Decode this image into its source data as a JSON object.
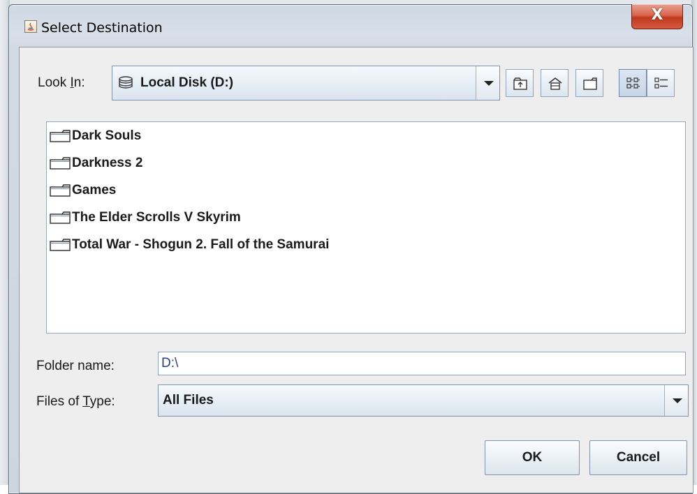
{
  "window": {
    "title": "Select Destination",
    "close_label": "X"
  },
  "look_in": {
    "label_pre": "Look ",
    "label_mnemonic": "I",
    "label_post": "n:",
    "value": "Local Disk (D:)",
    "icon": "drive-icon"
  },
  "toolbar": {
    "up_icon": "up-one-level-icon",
    "home_icon": "home-icon",
    "new_folder_icon": "new-folder-icon",
    "list_view_icon": "list-view-icon",
    "details_view_icon": "details-view-icon",
    "active_view": "list"
  },
  "files": [
    {
      "name": "Dark Souls",
      "icon": "folder-icon"
    },
    {
      "name": "Darkness 2",
      "icon": "folder-icon"
    },
    {
      "name": "Games",
      "icon": "folder-icon"
    },
    {
      "name": "The Elder Scrolls V Skyrim",
      "icon": "folder-icon"
    },
    {
      "name": "Total War - Shogun 2. Fall of the Samurai",
      "icon": "folder-icon"
    }
  ],
  "folder_name": {
    "label": "Folder name:",
    "value": "D:\\"
  },
  "files_of_type": {
    "label_pre": "Files of ",
    "label_mnemonic": "T",
    "label_post": "ype:",
    "value": "All Files"
  },
  "buttons": {
    "ok": "OK",
    "cancel": "Cancel"
  },
  "colors": {
    "close_button": "#c23a1e",
    "field_text": "#2a3f7e",
    "panel_bg": "#eeeeee"
  }
}
